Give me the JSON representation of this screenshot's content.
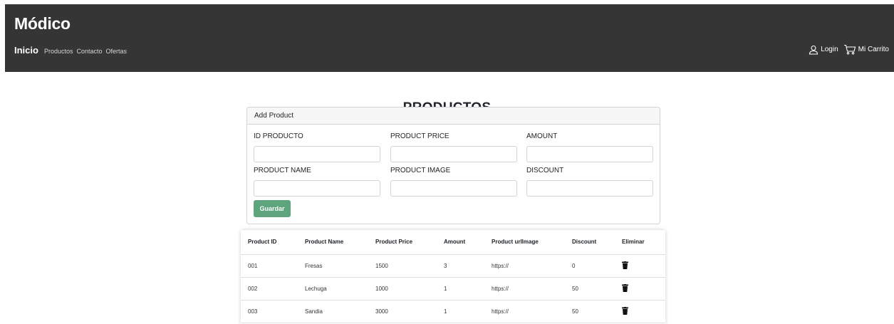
{
  "header": {
    "brand": "Módico",
    "nav": [
      "Inicio",
      "Productos",
      "Contacto",
      "Ofertas"
    ],
    "login_label": "Login",
    "cart_label": "Mi Carrito"
  },
  "page_title": "PRODUCTOS",
  "form": {
    "card_title": "Add Product",
    "fields": [
      {
        "label": "ID PRODUCTO",
        "value": ""
      },
      {
        "label": "PRODUCT PRICE",
        "value": ""
      },
      {
        "label": "AMOUNT",
        "value": ""
      },
      {
        "label": "PRODUCT NAME",
        "value": ""
      },
      {
        "label": "PRODUCT IMAGE",
        "value": ""
      },
      {
        "label": "DISCOUNT",
        "value": ""
      }
    ],
    "save_label": "Guardar"
  },
  "table": {
    "columns": [
      "Product ID",
      "Product Name",
      "Product Price",
      "Amount",
      "Product urlImage",
      "Discount",
      "Eliminar"
    ],
    "rows": [
      [
        "001",
        "Fresas",
        "1500",
        "3",
        "https://",
        "0"
      ],
      [
        "002",
        "Lechuga",
        "1000",
        "1",
        "https://",
        "50"
      ],
      [
        "003",
        "Sandia",
        "3000",
        "1",
        "https://",
        "50"
      ]
    ]
  },
  "colors": {
    "navbar_bg": "#353535",
    "save_button": "#5ea47c"
  },
  "icons": {
    "delete": "trash-icon",
    "user": "user-icon",
    "cart": "cart-icon"
  }
}
